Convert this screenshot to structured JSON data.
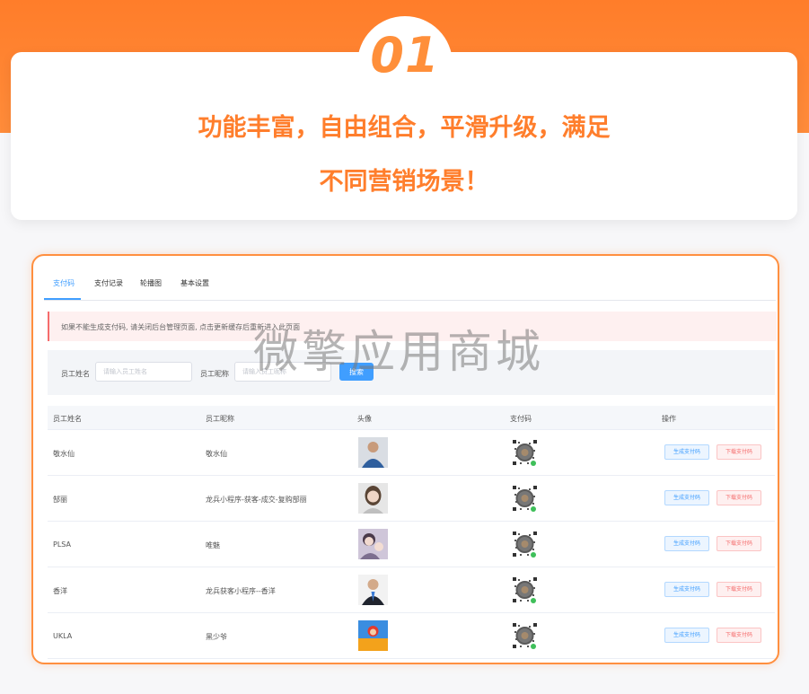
{
  "hero": {
    "badge_number": "01",
    "headline_line1": "功能丰富，自由组合，平滑升级，满足",
    "headline_line2": "不同营销场景！"
  },
  "tabs": [
    "支付码",
    "支付记录",
    "轮播图",
    "基本设置"
  ],
  "active_tab": "支付码",
  "alert": {
    "text": "如果不能生成支付码, 请关闭后台管理页面, 点击更新缓存后重新进入此页面"
  },
  "watermark": "微擎应用商城",
  "search": {
    "name_label": "员工姓名",
    "name_placeholder": "请输入员工姓名",
    "nickname_label": "员工昵称",
    "nickname_placeholder": "请输入员工昵称",
    "button_label": "搜索"
  },
  "table": {
    "headers": [
      "员工姓名",
      "员工昵称",
      "头像",
      "支付码",
      "操作"
    ],
    "rows": [
      {
        "name": "敬水仙",
        "nickname": "敬水仙",
        "avatar": "man-blue-jacket-photo",
        "generate": "生成支付码",
        "download": "下载支付码"
      },
      {
        "name": "郜丽",
        "nickname": "龙兵小程序-获客-成交-复购郜丽",
        "avatar": "woman-portrait-photo",
        "generate": "生成支付码",
        "download": "下载支付码"
      },
      {
        "name": "PLSA",
        "nickname": "唯魅",
        "avatar": "woman-with-child-photo",
        "generate": "生成支付码",
        "download": "下载支付码"
      },
      {
        "name": "香洋",
        "nickname": "龙兵获客小程序--香洋",
        "avatar": "man-suit-photo",
        "generate": "生成支付码",
        "download": "下载支付码"
      },
      {
        "name": "UKLA",
        "nickname": "黑少爷",
        "avatar": "cartoon-game-photo",
        "generate": "生成支付码",
        "download": "下载支付码"
      }
    ]
  },
  "colors": {
    "brand_orange": "#ff7e2c",
    "primary_blue": "#409eff",
    "danger_red": "#f56c6c"
  }
}
